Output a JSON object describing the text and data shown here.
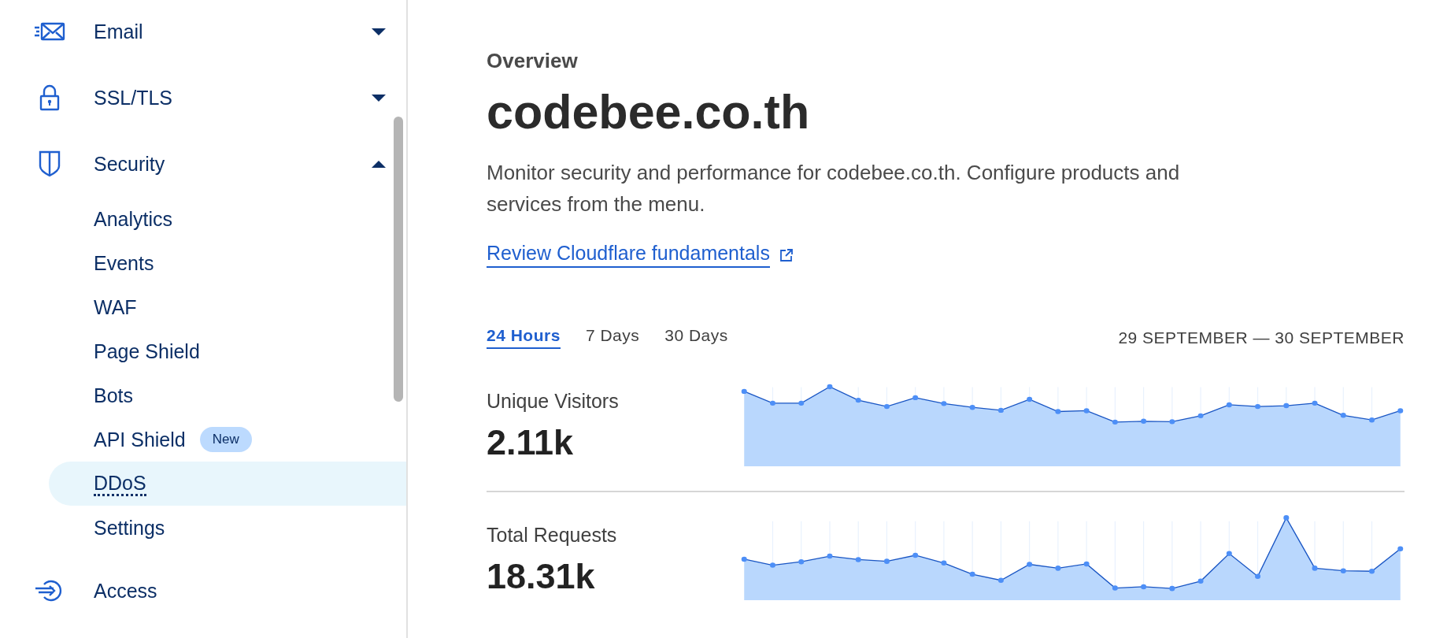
{
  "sidebar": {
    "items": [
      {
        "kind": "group",
        "label": "Email",
        "expanded": false
      },
      {
        "kind": "group",
        "label": "SSL/TLS",
        "expanded": false
      },
      {
        "kind": "group",
        "label": "Security",
        "expanded": true,
        "children": [
          {
            "label": "Analytics",
            "selected": false
          },
          {
            "label": "Events",
            "selected": false
          },
          {
            "label": "WAF",
            "selected": false
          },
          {
            "label": "Page Shield",
            "selected": false
          },
          {
            "label": "Bots",
            "selected": false
          },
          {
            "label": "API Shield",
            "selected": false,
            "badge": "New"
          },
          {
            "label": "DDoS",
            "selected": true
          },
          {
            "label": "Settings",
            "selected": false
          }
        ]
      },
      {
        "kind": "link",
        "label": "Access"
      }
    ]
  },
  "main": {
    "eyebrow": "Overview",
    "title": "codebee.co.th",
    "description": "Monitor security and performance for codebee.co.th. Configure products and services from the menu.",
    "link": "Review Cloudflare fundamentals",
    "ranges": [
      {
        "label": "24 Hours",
        "selected": true
      },
      {
        "label": "7 Days",
        "selected": false
      },
      {
        "label": "30 Days",
        "selected": false
      }
    ],
    "date_range": "29 SEPTEMBER — 30 SEPTEMBER",
    "metrics": [
      {
        "label": "Unique Visitors",
        "value": "2.11k"
      },
      {
        "label": "Total Requests",
        "value": "18.31k"
      }
    ]
  }
}
